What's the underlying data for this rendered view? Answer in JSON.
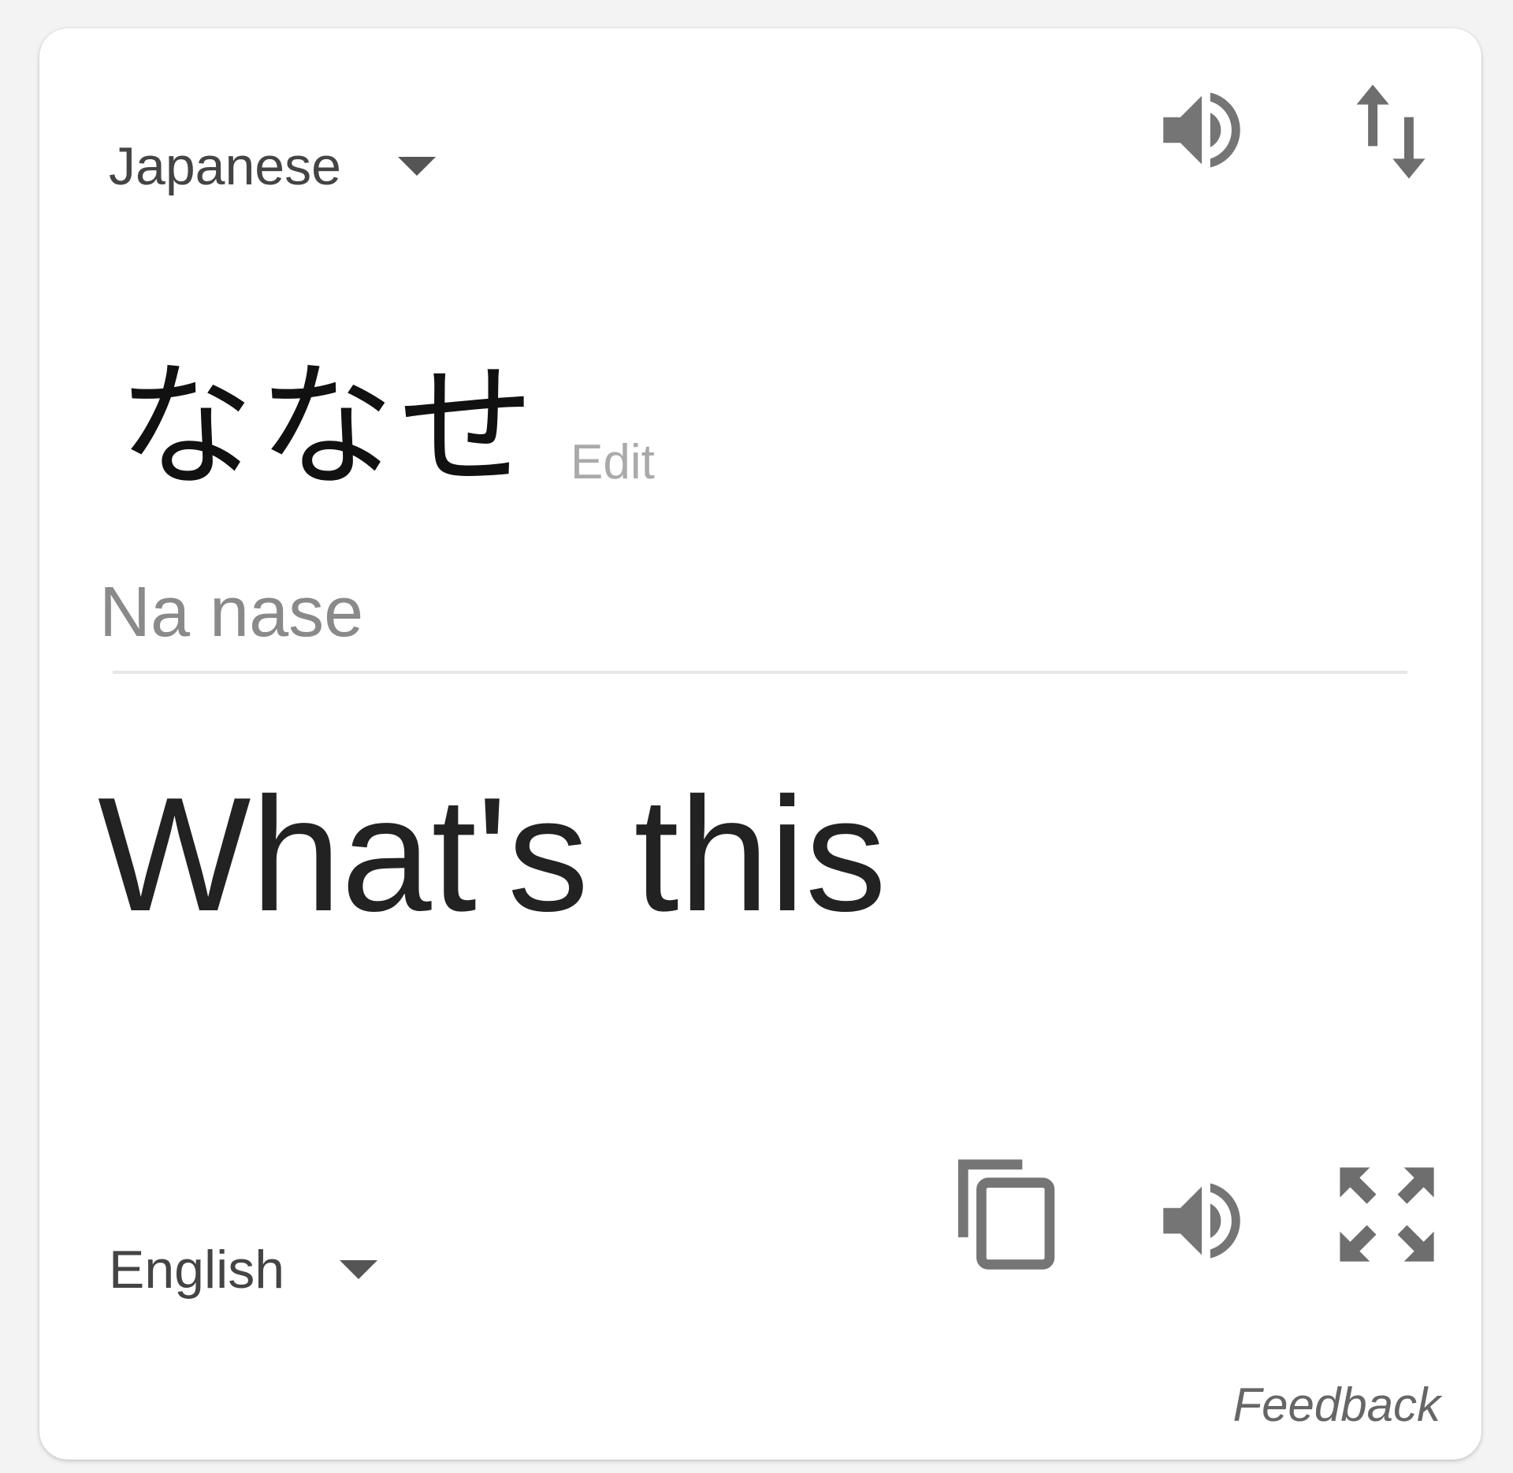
{
  "source": {
    "language": "Japanese",
    "text": "ななせ",
    "edit_label": "Edit",
    "romanization": "Na nase"
  },
  "target": {
    "language": "English",
    "text": "What's this"
  },
  "icons": {
    "source_listen": "speaker-icon",
    "swap": "swap-languages-icon",
    "copy": "copy-icon",
    "target_listen": "speaker-icon",
    "expand": "fullscreen-icon"
  },
  "feedback_label": "Feedback",
  "colors": {
    "icon": "#757575",
    "text_primary": "#222222",
    "text_secondary": "#8a8a8a"
  }
}
